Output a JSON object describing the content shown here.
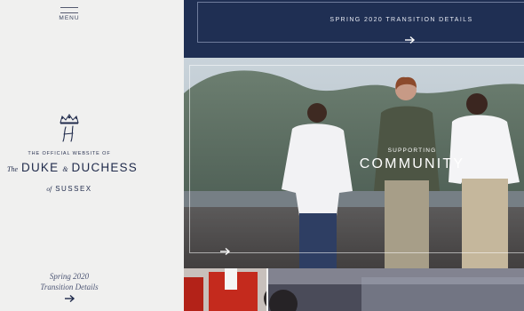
{
  "sidebar": {
    "menu_label": "MENU",
    "official_line": "THE OFFICIAL WEBSITE OF",
    "title_prefix": "The",
    "title_duke": "DUKE",
    "title_amp": "&",
    "title_duchess": "DUCHESS",
    "of_word": "of",
    "sussex": "SUSSEX",
    "link_line1": "Spring 2020",
    "link_line2": "Transition Details",
    "arrow_icon": "arrow-right-icon"
  },
  "banner": {
    "label": "SPRING 2020 TRANSITION DETAILS",
    "arrow_icon": "arrow-right-icon"
  },
  "hero": {
    "subtitle": "SUPPORTING",
    "title": "COMMUNITY",
    "arrow_icon": "arrow-right-icon"
  },
  "colors": {
    "navy": "#1f2f53",
    "sidebar_bg": "#f0f0ef",
    "text_navy": "#1f2a4b"
  }
}
